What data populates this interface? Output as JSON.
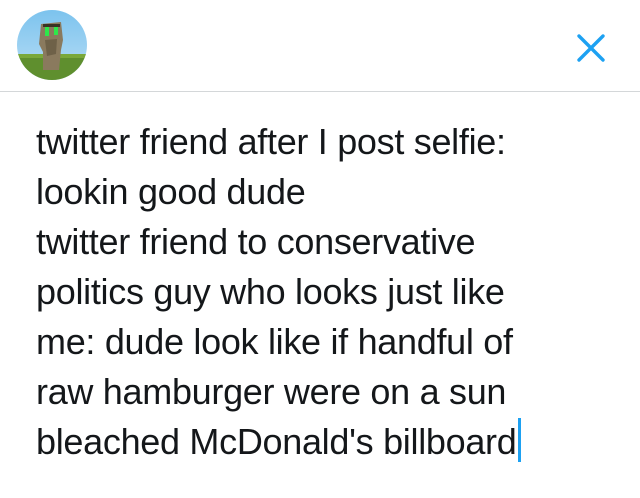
{
  "header": {
    "avatar_icon": "moai-statue-avatar",
    "close_icon": "close-x-icon",
    "accent_color": "#1da1f2"
  },
  "compose": {
    "lines": [
      "twitter friend after I post selfie:",
      "lookin good dude",
      "twitter friend to conservative",
      "politics guy who looks just like",
      "me: dude look like if handful of",
      "raw hamburger were on a sun",
      "bleached McDonald's billboard"
    ]
  }
}
